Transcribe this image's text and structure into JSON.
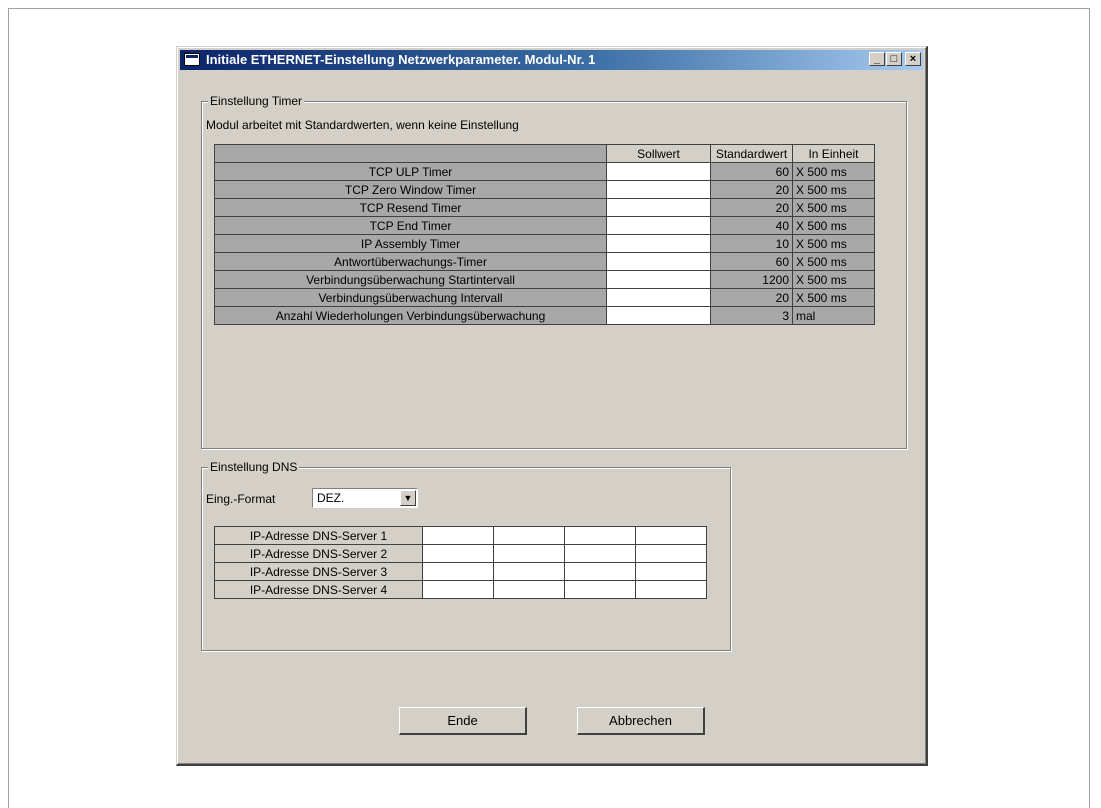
{
  "window": {
    "title": "Initiale ETHERNET-Einstellung Netzwerkparameter. Modul-Nr. 1",
    "minimize_glyph": "_",
    "maximize_glyph": "□",
    "close_glyph": "×"
  },
  "timer_group": {
    "label": "Einstellung Timer",
    "note": "Modul arbeitet mit Standardwerten, wenn keine Einstellung",
    "columns": [
      "Sollwert",
      "Standardwert",
      "In Einheit"
    ],
    "rows": [
      {
        "label": "TCP ULP Timer",
        "setpoint": "",
        "default": "60",
        "unit": "X 500 ms"
      },
      {
        "label": "TCP Zero Window Timer",
        "setpoint": "",
        "default": "20",
        "unit": "X 500 ms"
      },
      {
        "label": "TCP Resend Timer",
        "setpoint": "",
        "default": "20",
        "unit": "X 500 ms"
      },
      {
        "label": "TCP End Timer",
        "setpoint": "",
        "default": "40",
        "unit": "X 500 ms"
      },
      {
        "label": "IP Assembly Timer",
        "setpoint": "",
        "default": "10",
        "unit": "X 500 ms"
      },
      {
        "label": "Antwortüberwachungs-Timer",
        "setpoint": "",
        "default": "60",
        "unit": "X 500 ms"
      },
      {
        "label": "Verbindungsüberwachung Startintervall",
        "setpoint": "",
        "default": "1200",
        "unit": "X 500 ms"
      },
      {
        "label": "Verbindungsüberwachung Intervall",
        "setpoint": "",
        "default": "20",
        "unit": "X 500 ms"
      },
      {
        "label": "Anzahl Wiederholungen Verbindungsüberwachung",
        "setpoint": "",
        "default": "3",
        "unit": "mal"
      }
    ]
  },
  "dns_group": {
    "label": "Einstellung DNS",
    "format_label": "Eing.-Format",
    "format_value": "DEZ.",
    "servers": [
      {
        "label": "IP-Adresse DNS-Server 1",
        "octets": [
          "",
          "",
          "",
          ""
        ]
      },
      {
        "label": "IP-Adresse DNS-Server 2",
        "octets": [
          "",
          "",
          "",
          ""
        ]
      },
      {
        "label": "IP-Adresse DNS-Server 3",
        "octets": [
          "",
          "",
          "",
          ""
        ]
      },
      {
        "label": "IP-Adresse DNS-Server 4",
        "octets": [
          "",
          "",
          "",
          ""
        ]
      }
    ]
  },
  "buttons": {
    "end_label": "Ende",
    "cancel_label": "Abbrechen"
  },
  "colors": {
    "titlebar_start": "#0a246a",
    "dialog_face": "#d4d0c8",
    "readonly_cell": "#a8a8a8"
  }
}
